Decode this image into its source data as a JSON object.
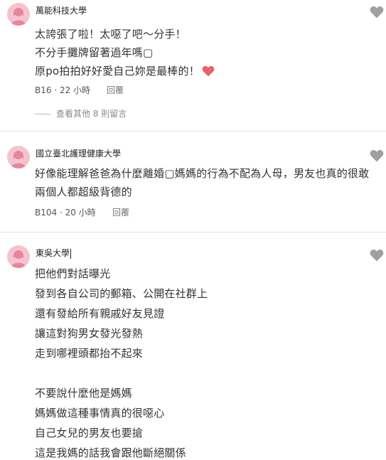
{
  "comments": [
    {
      "school": "萬能科技大學",
      "lines": [
        "太誇張了啦！太噁了吧～分手！",
        "不分手攤牌留著過年嗎▢",
        "原po拍拍好好愛自己妳是最棒的！"
      ],
      "floor": "B16",
      "time": "22 小時",
      "reply_label": "回覆",
      "view_more": "查看其他 8 則留言"
    },
    {
      "school": "國立臺北護理健康大學",
      "lines": [
        "好像能理解爸爸為什麼離婚▢媽媽的行為不配為人母，男友也真的很敢",
        "兩個人都超級背德的"
      ],
      "floor": "B104",
      "time": "20 小時",
      "reply_label": "回覆"
    },
    {
      "school": "東吳大學",
      "lines": [
        "把他們對話曝光",
        "發到各自公司的郵箱、公開在社群上",
        "還有發給所有親戚好友見證",
        "讓這對狗男女發光發熱",
        "走到哪裡頭都抬不起來",
        "",
        "不要說什麼他是媽媽",
        "媽媽做這種事情真的很噁心",
        "自己女兒的男友也要搶",
        "這是我媽的話我會跟他斷絕關係"
      ]
    }
  ],
  "colors": {
    "avatar_bg": "#f3c4cf",
    "avatar_fg": "#e8859b",
    "heart_gray": "#a0a0a0",
    "emoji_heart": "#e8616f"
  },
  "icons": {
    "like": "heart-icon",
    "avatar": "female-avatar-icon",
    "emoji": "red-heart-emoji"
  }
}
